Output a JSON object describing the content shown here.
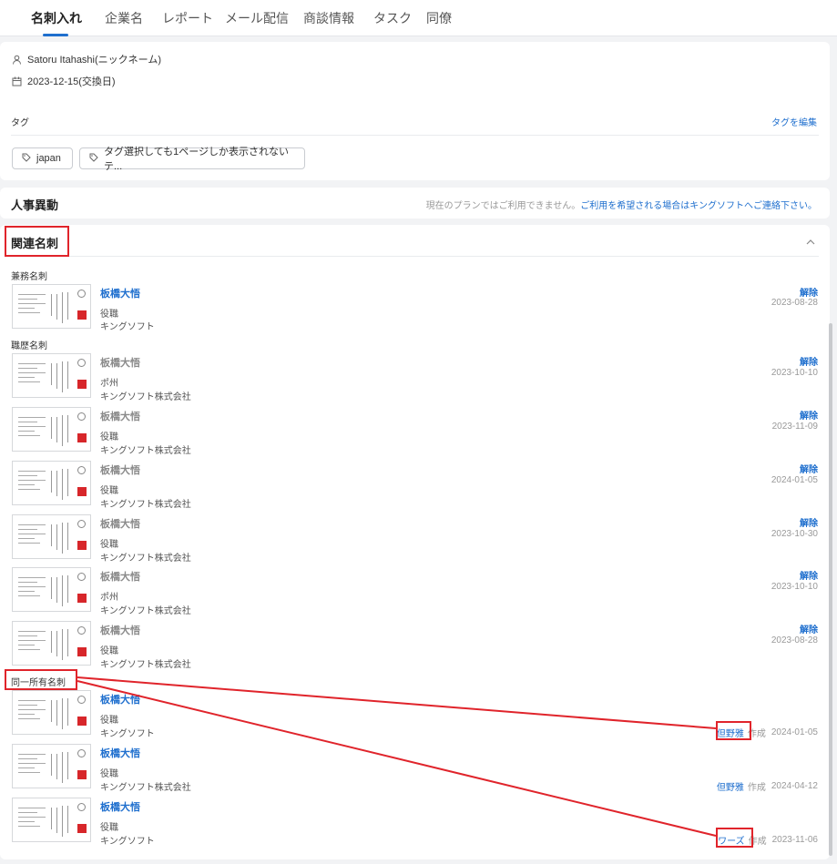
{
  "tabs": [
    "名刺入れ",
    "企業名",
    "レポート",
    "メール配信",
    "商談情報",
    "タスク",
    "同僚"
  ],
  "profile": {
    "nickname": "Satoru Itahashi(ニックネーム)",
    "exchange_date": "2023-12-15(交換日)"
  },
  "tags": {
    "heading": "タグ",
    "edit": "タグを編集",
    "items": [
      "japan",
      "タグ選択しても1ページしか表示されないテ..."
    ]
  },
  "hr_section": {
    "title": "人事異動",
    "notice_prefix": "現在のプランではご利用できません。",
    "notice_link": "ご利用を希望される場合はキングソフトへご連絡下さい。"
  },
  "related": {
    "title": "関連名刺",
    "groups": {
      "concurrent": "兼務名刺",
      "history": "職歴名刺",
      "shared": "同一所有名刺"
    },
    "concurrent_cards": [
      {
        "name": "板橋大悟",
        "role": "役職",
        "company": "キングソフト",
        "action": "解除",
        "date": "2023-08-28"
      }
    ],
    "history_cards": [
      {
        "name": "板橋大悟",
        "role": "ポ州",
        "company": "キングソフト株式会社",
        "action": "解除",
        "date": "2023-10-10"
      },
      {
        "name": "板橋大悟",
        "role": "役職",
        "company": "キングソフト株式会社",
        "action": "解除",
        "date": "2023-11-09"
      },
      {
        "name": "板橋大悟",
        "role": "役職",
        "company": "キングソフト株式会社",
        "action": "解除",
        "date": "2024-01-05"
      },
      {
        "name": "板橋大悟",
        "role": "役職",
        "company": "キングソフト株式会社",
        "action": "解除",
        "date": "2023-10-30"
      },
      {
        "name": "板橋大悟",
        "role": "ポ州",
        "company": "キングソフト株式会社",
        "action": "解除",
        "date": "2023-10-10"
      },
      {
        "name": "板橋大悟",
        "role": "役職",
        "company": "キングソフト株式会社",
        "action": "解除",
        "date": "2023-08-28"
      }
    ],
    "shared_cards": [
      {
        "name": "板橋大悟",
        "role": "役職",
        "company": "キングソフト",
        "owner": "但野雅",
        "created": "作成",
        "date": "2024-01-05"
      },
      {
        "name": "板橋大悟",
        "role": "役職",
        "company": "キングソフト株式会社",
        "owner": "但野雅",
        "created": "作成",
        "date": "2024-04-12"
      },
      {
        "name": "板橋大悟",
        "role": "役職",
        "company": "キングソフト",
        "owner": "ワーズ",
        "created": "作成",
        "date": "2023-11-06"
      }
    ]
  },
  "colors": {
    "accent": "#1f6fce",
    "annotation": "#e0242b"
  }
}
